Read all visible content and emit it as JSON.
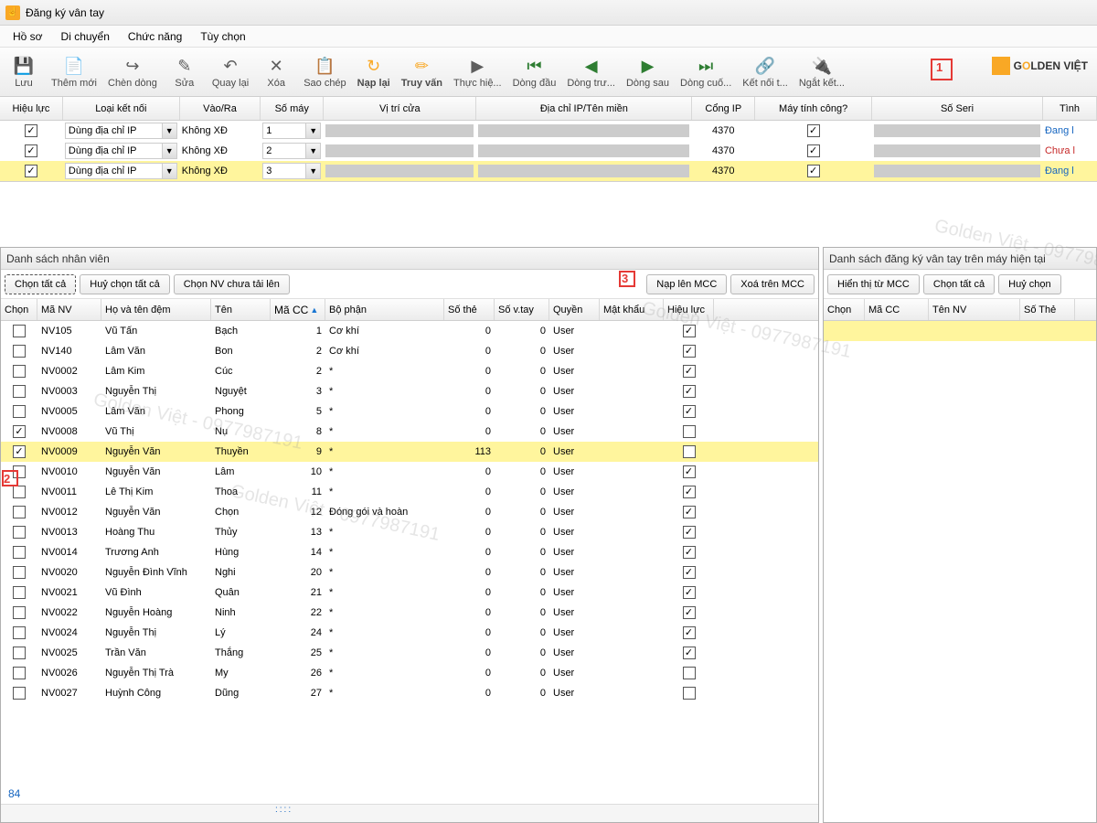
{
  "window": {
    "title": "Đăng ký vân tay"
  },
  "menu": [
    "Hồ sơ",
    "Di chuyển",
    "Chức năng",
    "Tùy chọn"
  ],
  "toolbar": [
    {
      "icon": "💾",
      "label": "Lưu"
    },
    {
      "icon": "📄",
      "label": "Thêm mới"
    },
    {
      "icon": "↪",
      "label": "Chèn dòng"
    },
    {
      "icon": "✎",
      "label": "Sửa"
    },
    {
      "icon": "↶",
      "label": "Quay lại"
    },
    {
      "icon": "✕",
      "label": "Xóa"
    },
    {
      "icon": "📋",
      "label": "Sao chép"
    },
    {
      "icon": "↻",
      "label": "Nạp lại"
    },
    {
      "icon": "✏",
      "label": "Truy vấn"
    },
    {
      "icon": "▶",
      "label": "Thực hiệ..."
    },
    {
      "icon": "⏮",
      "label": "Dòng đầu"
    },
    {
      "icon": "◀",
      "label": "Dòng trư..."
    },
    {
      "icon": "▶",
      "label": "Dòng sau"
    },
    {
      "icon": "⏭",
      "label": "Dòng cuố..."
    },
    {
      "icon": "🔗",
      "label": "Kết nối t..."
    },
    {
      "icon": "🔌",
      "label": "Ngắt kết..."
    }
  ],
  "logo_text": "GOLDEN VIỆT",
  "dev_headers": [
    "Hiệu lực",
    "Loại kết nối",
    "Vào/Ra",
    "Số máy",
    "Vị trí cửa",
    "Địa chỉ IP/Tên miền",
    "Cổng IP",
    "Máy tính công?",
    "Số Seri",
    "Tình"
  ],
  "dev_rows": [
    {
      "hl": true,
      "lk": "Dùng địa chỉ IP",
      "vr": "Không XĐ",
      "sm": "1",
      "cp": "4370",
      "mt": true,
      "st": "Đang l",
      "stc": "blue",
      "sel": false
    },
    {
      "hl": true,
      "lk": "Dùng địa chỉ IP",
      "vr": "Không XĐ",
      "sm": "2",
      "cp": "4370",
      "mt": true,
      "st": "Chưa l",
      "stc": "red",
      "sel": false
    },
    {
      "hl": true,
      "lk": "Dùng địa chỉ IP",
      "vr": "Không XĐ",
      "sm": "3",
      "cp": "4370",
      "mt": true,
      "st": "Đang l",
      "stc": "blue",
      "sel": true
    }
  ],
  "panel_l_title": "Danh sách nhân viên",
  "panel_r_title": "Danh sách đăng ký vân tay trên máy hiện tại",
  "btns_l": {
    "select_all": "Chọn tất cả",
    "deselect": "Huỷ chọn tất cả",
    "not_uploaded": "Chọn NV chưa tải lên",
    "upload": "Nạp lên MCC",
    "delete": "Xoá trên MCC"
  },
  "btns_r": {
    "show": "Hiển thị từ MCC",
    "select_all": "Chọn tất cả",
    "deselect": "Huỷ chọn"
  },
  "emp_headers": [
    "Chọn",
    "Mã NV",
    "Họ và tên đệm",
    "Tên",
    "Mã CC",
    "Bộ phận",
    "Số thẻ",
    "Số v.tay",
    "Quyền",
    "Mật khẩu",
    "Hiệu lực"
  ],
  "emp_rows": [
    {
      "ch": false,
      "mn": "NV105",
      "ht": "Vũ Tấn",
      "tn": "Bạch",
      "mc": "1",
      "bp": "Cơ khí",
      "st": "0",
      "sv": "0",
      "qy": "User",
      "hl": true
    },
    {
      "ch": false,
      "mn": "NV140",
      "ht": "Lâm Văn",
      "tn": "Bon",
      "mc": "2",
      "bp": "Cơ khí",
      "st": "0",
      "sv": "0",
      "qy": "User",
      "hl": true
    },
    {
      "ch": false,
      "mn": "NV0002",
      "ht": "Lâm Kim",
      "tn": "Cúc",
      "mc": "2",
      "bp": "*",
      "st": "0",
      "sv": "0",
      "qy": "User",
      "hl": true
    },
    {
      "ch": false,
      "mn": "NV0003",
      "ht": "Nguyễn Thị",
      "tn": "Nguyệt",
      "mc": "3",
      "bp": "*",
      "st": "0",
      "sv": "0",
      "qy": "User",
      "hl": true
    },
    {
      "ch": false,
      "mn": "NV0005",
      "ht": "Lâm Văn",
      "tn": "Phong",
      "mc": "5",
      "bp": "*",
      "st": "0",
      "sv": "0",
      "qy": "User",
      "hl": true
    },
    {
      "ch": true,
      "mn": "NV0008",
      "ht": "Vũ Thị",
      "tn": "Nụ",
      "mc": "8",
      "bp": "*",
      "st": "0",
      "sv": "0",
      "qy": "User",
      "hl": false
    },
    {
      "ch": true,
      "mn": "NV0009",
      "ht": "Nguyễn Văn",
      "tn": "Thuyền",
      "mc": "9",
      "bp": "*",
      "st": "113",
      "sv": "0",
      "qy": "User",
      "hl": false,
      "sel": true
    },
    {
      "ch": false,
      "mn": "NV0010",
      "ht": "Nguyễn Văn",
      "tn": "Lâm",
      "mc": "10",
      "bp": "*",
      "st": "0",
      "sv": "0",
      "qy": "User",
      "hl": true
    },
    {
      "ch": false,
      "mn": "NV0011",
      "ht": "Lê Thị Kim",
      "tn": "Thoa",
      "mc": "11",
      "bp": "*",
      "st": "0",
      "sv": "0",
      "qy": "User",
      "hl": true
    },
    {
      "ch": false,
      "mn": "NV0012",
      "ht": "Nguyễn Văn",
      "tn": "Chọn",
      "mc": "12",
      "bp": "Đóng gói và hoàn",
      "st": "0",
      "sv": "0",
      "qy": "User",
      "hl": true
    },
    {
      "ch": false,
      "mn": "NV0013",
      "ht": "Hoàng Thu",
      "tn": "Thủy",
      "mc": "13",
      "bp": "*",
      "st": "0",
      "sv": "0",
      "qy": "User",
      "hl": true
    },
    {
      "ch": false,
      "mn": "NV0014",
      "ht": "Trương Anh",
      "tn": "Hùng",
      "mc": "14",
      "bp": "*",
      "st": "0",
      "sv": "0",
      "qy": "User",
      "hl": true
    },
    {
      "ch": false,
      "mn": "NV0020",
      "ht": "Nguyễn Đình Vĩnh",
      "tn": "Nghi",
      "mc": "20",
      "bp": "*",
      "st": "0",
      "sv": "0",
      "qy": "User",
      "hl": true
    },
    {
      "ch": false,
      "mn": "NV0021",
      "ht": "Vũ Đình",
      "tn": "Quân",
      "mc": "21",
      "bp": "*",
      "st": "0",
      "sv": "0",
      "qy": "User",
      "hl": true
    },
    {
      "ch": false,
      "mn": "NV0022",
      "ht": "Nguyễn Hoàng",
      "tn": "Ninh",
      "mc": "22",
      "bp": "*",
      "st": "0",
      "sv": "0",
      "qy": "User",
      "hl": true
    },
    {
      "ch": false,
      "mn": "NV0024",
      "ht": "Nguyễn Thị",
      "tn": "Lý",
      "mc": "24",
      "bp": "*",
      "st": "0",
      "sv": "0",
      "qy": "User",
      "hl": true
    },
    {
      "ch": false,
      "mn": "NV0025",
      "ht": "Trần Văn",
      "tn": "Thắng",
      "mc": "25",
      "bp": "*",
      "st": "0",
      "sv": "0",
      "qy": "User",
      "hl": true
    },
    {
      "ch": false,
      "mn": "NV0026",
      "ht": "Nguyễn Thị Trà",
      "tn": "My",
      "mc": "26",
      "bp": "*",
      "st": "0",
      "sv": "0",
      "qy": "User",
      "hl": false
    },
    {
      "ch": false,
      "mn": "NV0027",
      "ht": "Huỳnh Công",
      "tn": "Dũng",
      "mc": "27",
      "bp": "*",
      "st": "0",
      "sv": "0",
      "qy": "User",
      "hl": false
    }
  ],
  "emp_count": "84",
  "fp_headers": [
    "Chọn",
    "Mã CC",
    "Tên NV",
    "Số Thẻ"
  ],
  "watermark": "Golden Việt - 0977987191"
}
